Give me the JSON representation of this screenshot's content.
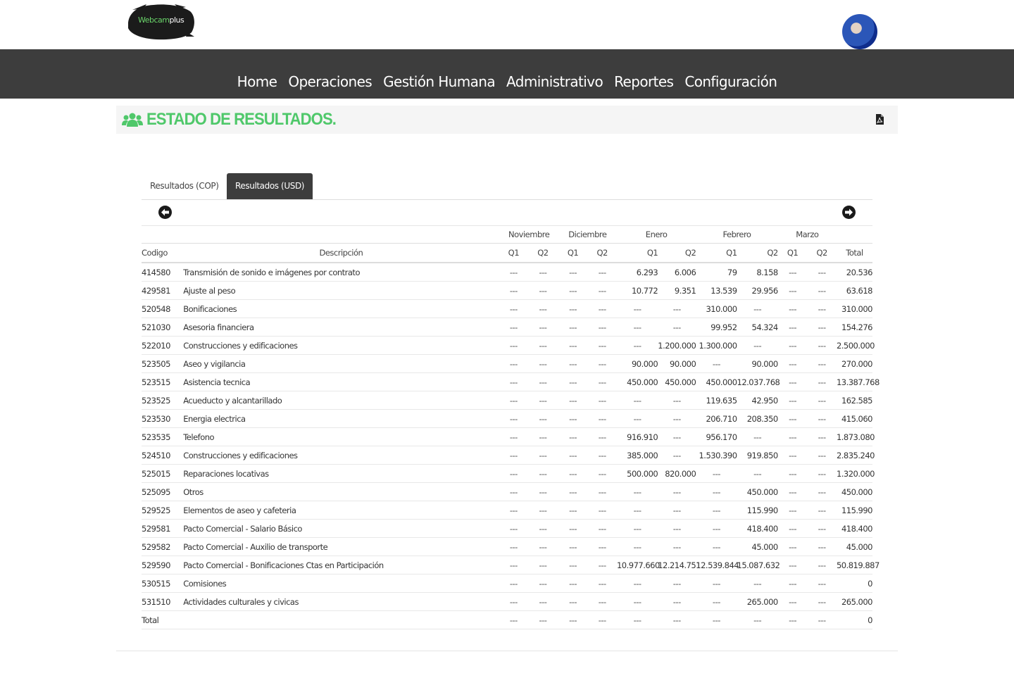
{
  "brand": {
    "logo_prefix": "Webcam",
    "logo_suffix": "plus"
  },
  "nav": [
    "Home",
    "Operaciones",
    "Gestión Humana",
    "Administrativo",
    "Reportes",
    "Configuración"
  ],
  "page": {
    "title": "ESTADO DE RESULTADOS."
  },
  "tabs": [
    {
      "label": "Resultados (COP)",
      "active": false
    },
    {
      "label": "Resultados (USD)",
      "active": true
    }
  ],
  "table": {
    "months": [
      "Noviembre",
      "Diciembre",
      "Enero",
      "Febrero",
      "Marzo"
    ],
    "headers": {
      "codigo": "Codigo",
      "descripcion": "Descripción",
      "q1": "Q1",
      "q2": "Q2",
      "total": "Total"
    },
    "rows": [
      {
        "code": "414580",
        "desc": "Transmisión de sonido e imágenes por contrato",
        "vals": [
          "---",
          "---",
          "---",
          "---",
          "6.293",
          "6.006",
          "79",
          "8.158",
          "---",
          "---"
        ],
        "total": "20.536"
      },
      {
        "code": "429581",
        "desc": "Ajuste al peso",
        "vals": [
          "---",
          "---",
          "---",
          "---",
          "10.772",
          "9.351",
          "13.539",
          "29.956",
          "---",
          "---"
        ],
        "total": "63.618"
      },
      {
        "code": "520548",
        "desc": "Bonificaciones",
        "vals": [
          "---",
          "---",
          "---",
          "---",
          "---",
          "---",
          "310.000",
          "---",
          "---",
          "---"
        ],
        "total": "310.000"
      },
      {
        "code": "521030",
        "desc": "Asesoria financiera",
        "vals": [
          "---",
          "---",
          "---",
          "---",
          "---",
          "---",
          "99.952",
          "54.324",
          "---",
          "---"
        ],
        "total": "154.276"
      },
      {
        "code": "522010",
        "desc": "Construcciones y edificaciones",
        "vals": [
          "---",
          "---",
          "---",
          "---",
          "---",
          "1.200.000",
          "1.300.000",
          "---",
          "---",
          "---"
        ],
        "total": "2.500.000"
      },
      {
        "code": "523505",
        "desc": "Aseo y vigilancia",
        "vals": [
          "---",
          "---",
          "---",
          "---",
          "90.000",
          "90.000",
          "---",
          "90.000",
          "---",
          "---"
        ],
        "total": "270.000"
      },
      {
        "code": "523515",
        "desc": "Asistencia tecnica",
        "vals": [
          "---",
          "---",
          "---",
          "---",
          "450.000",
          "450.000",
          "450.000",
          "12.037.768",
          "---",
          "---"
        ],
        "total": "13.387.768"
      },
      {
        "code": "523525",
        "desc": "Acueducto y alcantarillado",
        "vals": [
          "---",
          "---",
          "---",
          "---",
          "---",
          "---",
          "119.635",
          "42.950",
          "---",
          "---"
        ],
        "total": "162.585"
      },
      {
        "code": "523530",
        "desc": "Energia electrica",
        "vals": [
          "---",
          "---",
          "---",
          "---",
          "---",
          "---",
          "206.710",
          "208.350",
          "---",
          "---"
        ],
        "total": "415.060"
      },
      {
        "code": "523535",
        "desc": "Telefono",
        "vals": [
          "---",
          "---",
          "---",
          "---",
          "916.910",
          "---",
          "956.170",
          "---",
          "---",
          "---"
        ],
        "total": "1.873.080"
      },
      {
        "code": "524510",
        "desc": "Construcciones y edificaciones",
        "vals": [
          "---",
          "---",
          "---",
          "---",
          "385.000",
          "---",
          "1.530.390",
          "919.850",
          "---",
          "---"
        ],
        "total": "2.835.240"
      },
      {
        "code": "525015",
        "desc": "Reparaciones locativas",
        "vals": [
          "---",
          "---",
          "---",
          "---",
          "500.000",
          "820.000",
          "---",
          "---",
          "---",
          "---"
        ],
        "total": "1.320.000"
      },
      {
        "code": "525095",
        "desc": "Otros",
        "vals": [
          "---",
          "---",
          "---",
          "---",
          "---",
          "---",
          "---",
          "450.000",
          "---",
          "---"
        ],
        "total": "450.000"
      },
      {
        "code": "529525",
        "desc": "Elementos de aseo y cafeteria",
        "vals": [
          "---",
          "---",
          "---",
          "---",
          "---",
          "---",
          "---",
          "115.990",
          "---",
          "---"
        ],
        "total": "115.990"
      },
      {
        "code": "529581",
        "desc": "Pacto Comercial - Salario Básico",
        "vals": [
          "---",
          "---",
          "---",
          "---",
          "---",
          "---",
          "---",
          "418.400",
          "---",
          "---"
        ],
        "total": "418.400"
      },
      {
        "code": "529582",
        "desc": "Pacto Comercial - Auxilio de transporte",
        "vals": [
          "---",
          "---",
          "---",
          "---",
          "---",
          "---",
          "---",
          "45.000",
          "---",
          "---"
        ],
        "total": "45.000"
      },
      {
        "code": "529590",
        "desc": "Pacto Comercial - Bonificaciones Ctas en Participación",
        "vals": [
          "---",
          "---",
          "---",
          "---",
          "10.977.660",
          "12.214.751",
          "12.539.844",
          "15.087.632",
          "---",
          "---"
        ],
        "total": "50.819.887"
      },
      {
        "code": "530515",
        "desc": "Comisiones",
        "vals": [
          "---",
          "---",
          "---",
          "---",
          "---",
          "---",
          "---",
          "---",
          "---",
          "---"
        ],
        "total": "0"
      },
      {
        "code": "531510",
        "desc": "Actividades culturales y civicas",
        "vals": [
          "---",
          "---",
          "---",
          "---",
          "---",
          "---",
          "---",
          "265.000",
          "---",
          "---"
        ],
        "total": "265.000"
      }
    ],
    "total_row": {
      "label": "Total",
      "vals": [
        "---",
        "---",
        "---",
        "---",
        "---",
        "---",
        "---",
        "---",
        "---",
        "---"
      ],
      "total": "0"
    }
  }
}
